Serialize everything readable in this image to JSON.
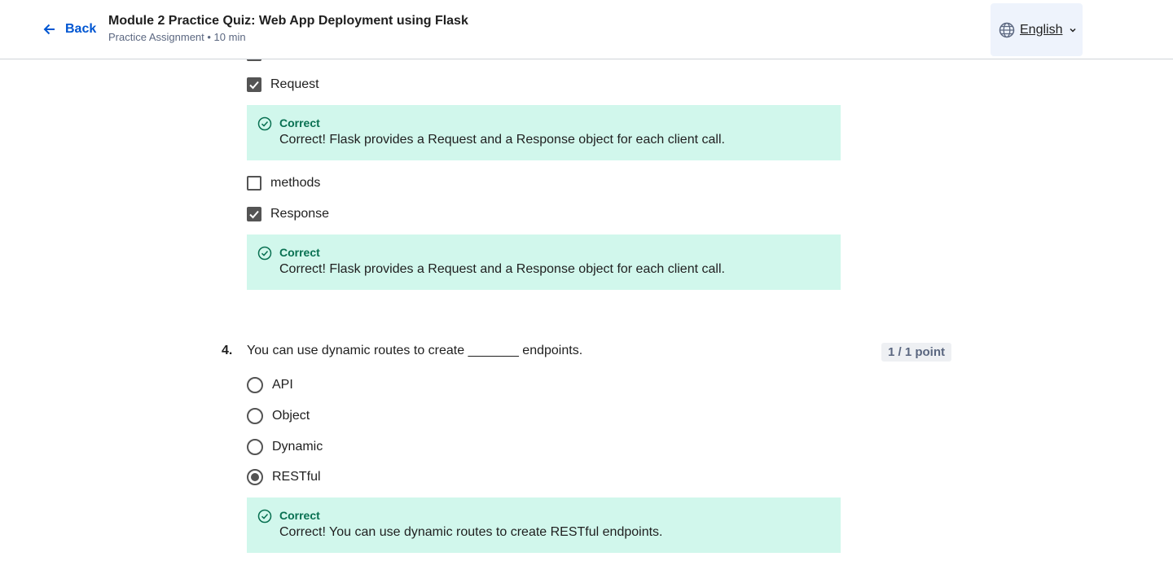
{
  "header": {
    "back_label": "Back",
    "title": "Module 2 Practice Quiz: Web App Deployment using Flask",
    "subtitle": "Practice Assignment • 10 min",
    "language": "English"
  },
  "question3": {
    "options": [
      {
        "label": "Request",
        "checked": true
      },
      {
        "label": "methods",
        "checked": false
      },
      {
        "label": "Response",
        "checked": true
      }
    ],
    "feedback": [
      {
        "title": "Correct",
        "text": "Correct! Flask provides a Request and a Response object for each client call."
      },
      {
        "title": "Correct",
        "text": "Correct! Flask provides a Request and a Response object for each client call."
      }
    ]
  },
  "question4": {
    "number": "4.",
    "text": "You can use dynamic routes to create _______ endpoints.",
    "points": "1 / 1 point",
    "options": [
      {
        "label": "API",
        "selected": false
      },
      {
        "label": "Object",
        "selected": false
      },
      {
        "label": "Dynamic",
        "selected": false
      },
      {
        "label": "RESTful",
        "selected": true
      }
    ],
    "feedback": {
      "title": "Correct",
      "text": "Correct! You can use dynamic routes to create RESTful endpoints."
    }
  },
  "colors": {
    "accent": "#0056d2",
    "feedback_bg": "#d1f7ec",
    "feedback_title": "#087051"
  }
}
